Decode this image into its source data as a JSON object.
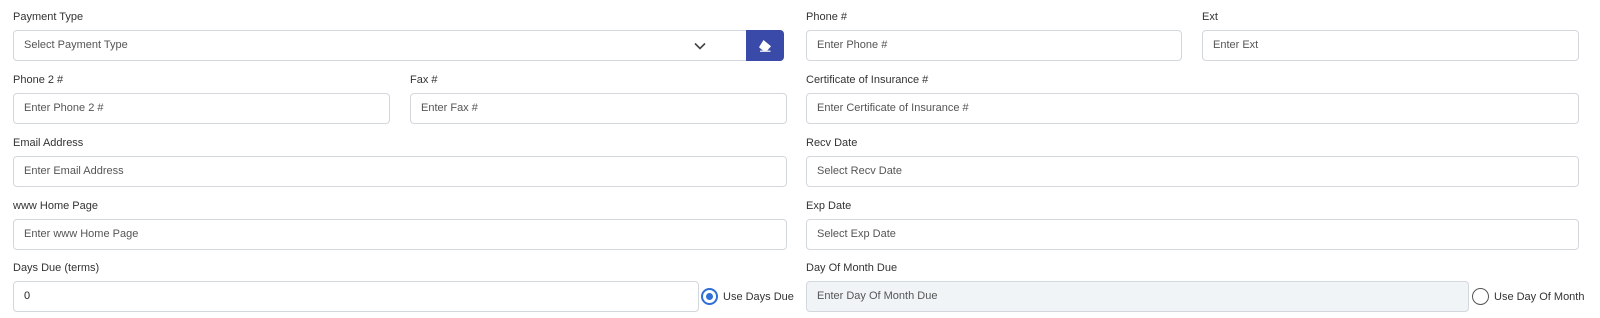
{
  "payment_type": {
    "label": "Payment Type",
    "placeholder": "Select Payment Type"
  },
  "phone": {
    "label": "Phone #",
    "placeholder": "Enter Phone #"
  },
  "ext": {
    "label": "Ext",
    "placeholder": "Enter Ext"
  },
  "phone2": {
    "label": "Phone 2 #",
    "placeholder": "Enter Phone 2 #"
  },
  "fax": {
    "label": "Fax #",
    "placeholder": "Enter Fax #"
  },
  "certificate": {
    "label": "Certificate of Insurance #",
    "placeholder": "Enter Certificate of Insurance #"
  },
  "email": {
    "label": "Email Address",
    "placeholder": "Enter Email Address"
  },
  "recv_date": {
    "label": "Recv Date",
    "placeholder": "Select Recv Date"
  },
  "home_page": {
    "label": "www Home Page",
    "placeholder": "Enter www Home Page"
  },
  "exp_date": {
    "label": "Exp Date",
    "placeholder": "Select Exp Date"
  },
  "days_due": {
    "label": "Days Due (terms)",
    "value": "0",
    "option_label": "Use Days Due",
    "option_selected": true
  },
  "day_of_month_due": {
    "label": "Day Of Month Due",
    "placeholder": "Enter Day Of Month Due",
    "option_label": "Use Day Of Month",
    "option_selected": false
  },
  "colors": {
    "accent": "#3a4aa8",
    "radio": "#2f6fd6",
    "border": "#d3d7de",
    "disabled_bg": "#f1f4f7"
  },
  "icons": {
    "dropdown": "chevron-down-icon",
    "clear": "eraser-icon"
  }
}
